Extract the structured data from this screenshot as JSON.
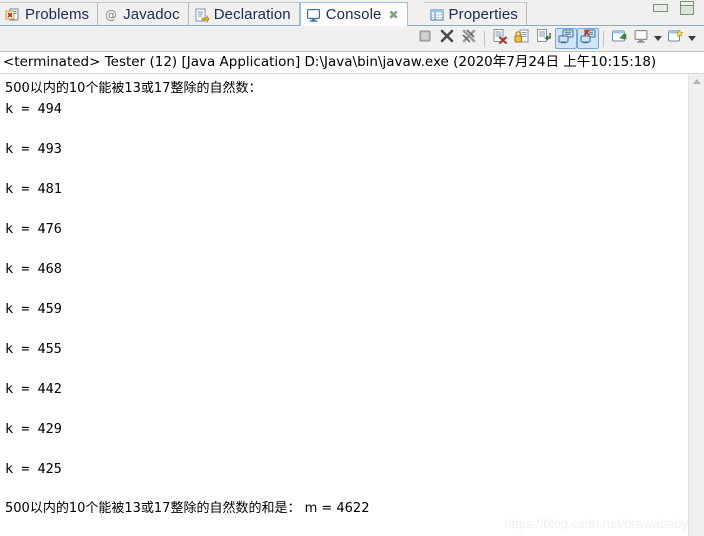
{
  "window": {
    "minimize_label": "Minimize",
    "maximize_label": "Maximize"
  },
  "tabs": [
    {
      "label": "Problems",
      "icon": "problems-icon",
      "active": false,
      "closable": false
    },
    {
      "label": "Javadoc",
      "icon": "javadoc-icon",
      "active": false,
      "closable": false
    },
    {
      "label": "Declaration",
      "icon": "declaration-icon",
      "active": false,
      "closable": false
    },
    {
      "label": "Console",
      "icon": "console-icon",
      "active": true,
      "closable": true,
      "close_glyph": "✖"
    },
    {
      "label": "Properties",
      "icon": "properties-icon",
      "active": false,
      "closable": false
    }
  ],
  "toolbar": {
    "buttons": [
      {
        "name": "terminate-button",
        "icon": "stop-square-icon",
        "toggled": false
      },
      {
        "name": "remove-launch-button",
        "icon": "remove-x-icon",
        "toggled": false
      },
      {
        "name": "remove-all-terminated-button",
        "icon": "remove-all-x-icon",
        "toggled": false
      },
      {
        "name": "clear-console-button",
        "icon": "clear-console-icon",
        "toggled": false
      },
      {
        "name": "scroll-lock-button",
        "icon": "scroll-lock-icon",
        "toggled": false
      },
      {
        "name": "word-wrap-button",
        "icon": "word-wrap-icon",
        "toggled": false
      },
      {
        "name": "show-console-on-output-button",
        "icon": "show-console-output-icon",
        "toggled": true
      },
      {
        "name": "show-console-on-error-button",
        "icon": "show-console-error-icon",
        "toggled": true
      },
      {
        "name": "pin-console-button",
        "icon": "pin-console-icon",
        "toggled": false
      },
      {
        "name": "display-selected-console-button",
        "icon": "display-console-icon",
        "toggled": false
      },
      {
        "name": "open-console-button",
        "icon": "open-console-icon",
        "toggled": false
      }
    ]
  },
  "console": {
    "header": "<terminated> Tester (12) [Java Application] D:\\Java\\bin\\javaw.exe (2020年7月24日 上午10:15:18)",
    "lines": [
      "500以内的10个能被13或17整除的自然数：",
      "k = 494",
      "",
      "k = 493",
      "",
      "k = 481",
      "",
      "k = 476",
      "",
      "k = 468",
      "",
      "k = 459",
      "",
      "k = 455",
      "",
      "k = 442",
      "",
      "k = 429",
      "",
      "k = 425",
      "",
      "500以内的10个能被13或17整除的自然数的和是： m = 4622"
    ]
  },
  "watermark": {
    "text": "https://blog.csdn.net/drawababy"
  },
  "colors": {
    "tab_text": "#1d2a52",
    "active_tab_bg": "#fdfdfd",
    "chrome_bg": "#f0f0ef",
    "console_bg": "#ffffff",
    "toggle_highlight": "#cfe4f7",
    "underline": "#8fa9c9"
  }
}
